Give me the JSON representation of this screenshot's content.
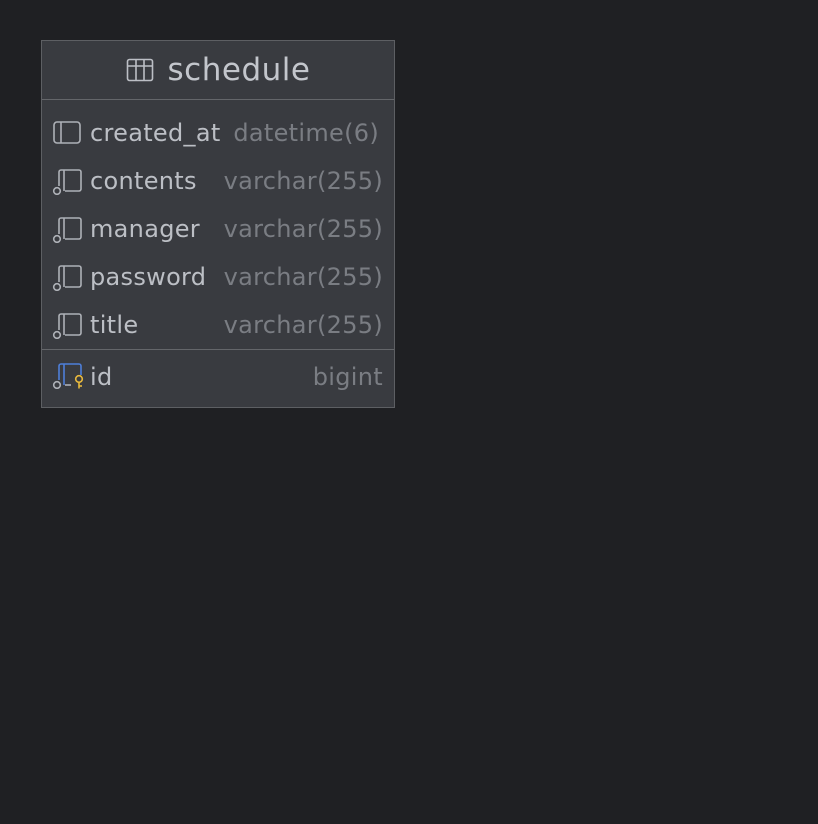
{
  "table": {
    "name": "schedule",
    "icon": "table-icon",
    "columns": [
      {
        "name": "created_at",
        "type": "datetime(6)",
        "icon": "column-icon"
      },
      {
        "name": "contents",
        "type": "varchar(255)",
        "icon": "nullable-column-icon"
      },
      {
        "name": "manager",
        "type": "varchar(255)",
        "icon": "nullable-column-icon"
      },
      {
        "name": "password",
        "type": "varchar(255)",
        "icon": "nullable-column-icon"
      },
      {
        "name": "title",
        "type": "varchar(255)",
        "icon": "nullable-column-icon"
      }
    ],
    "primary_key": {
      "name": "id",
      "type": "bigint",
      "icon": "primary-key-icon"
    }
  },
  "colors": {
    "background": "#1f2023",
    "card": "#393b40",
    "border": "#64666a",
    "key_accent": "#e8b93d",
    "pk_icon_blue": "#4e7fd9"
  }
}
